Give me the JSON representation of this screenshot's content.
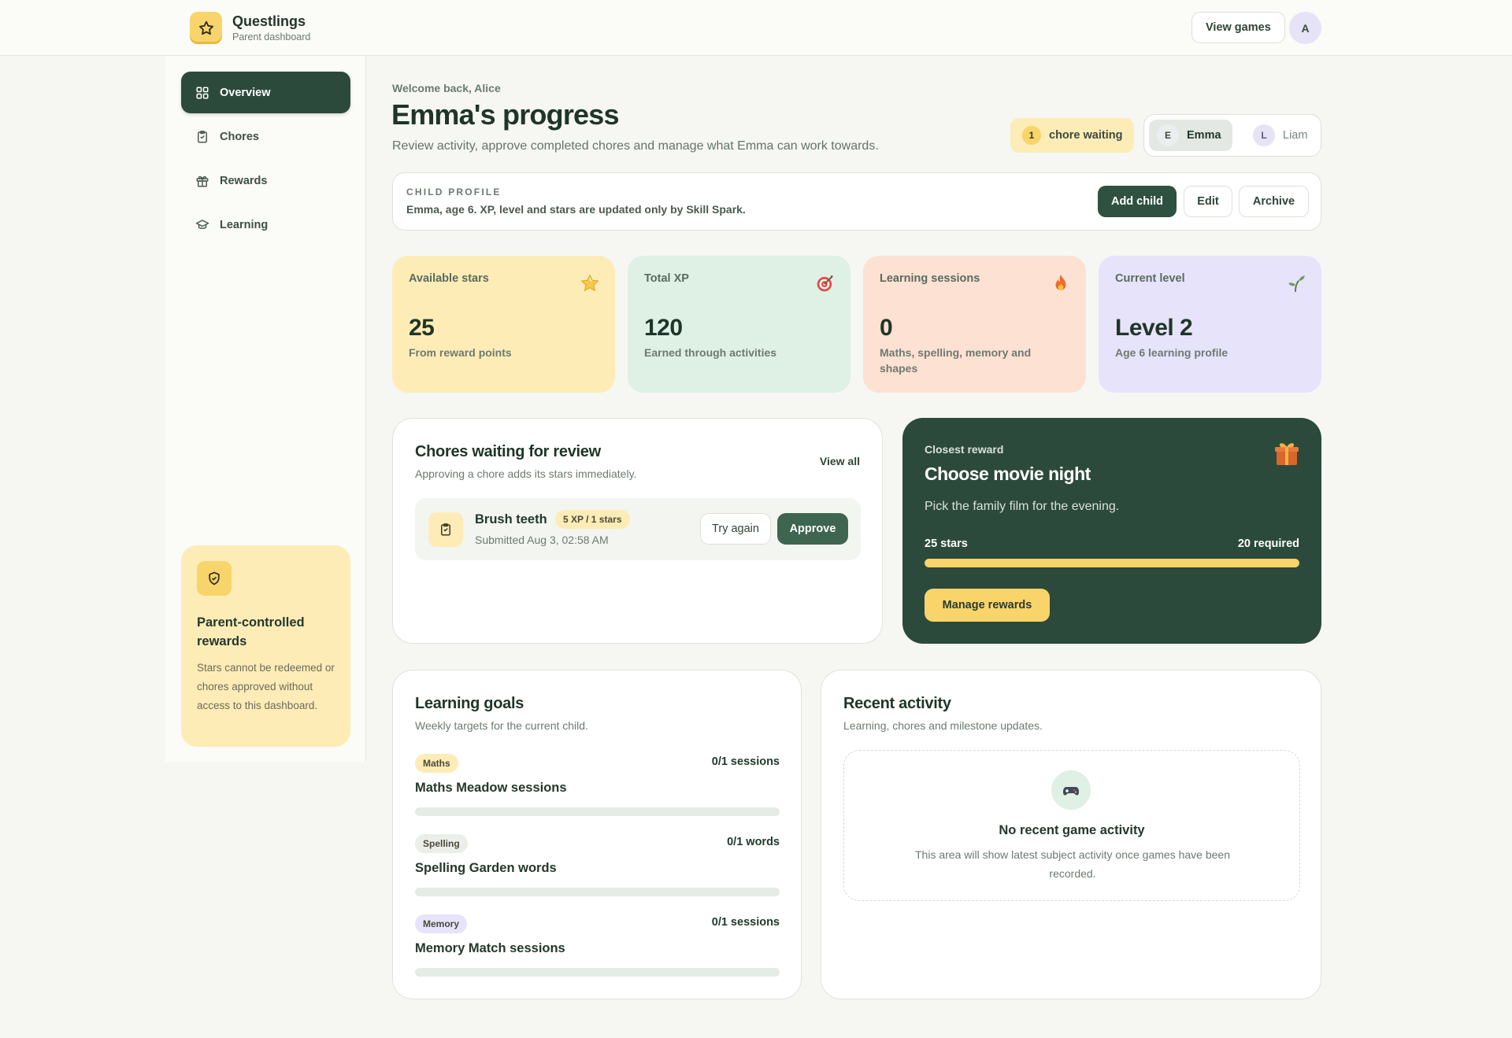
{
  "app": {
    "name": "Questlings",
    "subtitle": "Parent dashboard",
    "view_games_label": "View games",
    "user_initial": "A",
    "logo_icon": "star-icon"
  },
  "sidebar": {
    "items": [
      {
        "label": "Overview",
        "icon": "grid-icon",
        "active": true
      },
      {
        "label": "Chores",
        "icon": "clipboard-icon",
        "active": false
      },
      {
        "label": "Rewards",
        "icon": "gift-icon",
        "active": false
      },
      {
        "label": "Learning",
        "icon": "graduation-cap-icon",
        "active": false
      }
    ],
    "card": {
      "icon": "shield-check-icon",
      "title": "Parent-controlled rewards",
      "text": "Stars cannot be redeemed or chores approved without access to this dashboard."
    }
  },
  "header": {
    "welcome": "Welcome back, Alice",
    "title": "Emma's progress",
    "subtitle": "Review activity, approve completed chores and manage what Emma can work towards.",
    "chore_waiting": {
      "count": "1",
      "label": "chore waiting"
    },
    "children": [
      {
        "initial": "E",
        "name": "Emma",
        "selected": true
      },
      {
        "initial": "L",
        "name": "Liam",
        "selected": false
      }
    ]
  },
  "profile": {
    "label": "CHILD PROFILE",
    "text": "Emma, age 6. XP, level and stars are updated only by Skill Spark.",
    "add_child": "Add child",
    "edit": "Edit",
    "archive": "Archive"
  },
  "stats": [
    {
      "label": "Available stars",
      "value": "25",
      "sub": "From reward points",
      "icon": "star-emoji-icon"
    },
    {
      "label": "Total XP",
      "value": "120",
      "sub": "Earned through activities",
      "icon": "target-icon"
    },
    {
      "label": "Learning sessions",
      "value": "0",
      "sub": "Maths, spelling, memory and shapes",
      "icon": "fire-icon"
    },
    {
      "label": "Current level",
      "value": "Level 2",
      "sub": "Age 6 learning profile",
      "icon": "seedling-icon"
    }
  ],
  "chores": {
    "title": "Chores waiting for review",
    "subtitle": "Approving a chore adds its stars immediately.",
    "view_all": "View all",
    "items": [
      {
        "name": "Brush teeth",
        "badge": "5 XP / 1 stars",
        "submitted": "Submitted Aug 3, 02:58 AM",
        "try_again": "Try again",
        "approve": "Approve"
      }
    ]
  },
  "reward": {
    "label": "Closest reward",
    "title": "Choose movie night",
    "description": "Pick the family film for the evening.",
    "have": "25 stars",
    "need": "20 required",
    "progress": 1.0,
    "button": "Manage rewards",
    "icon": "gift-box-icon"
  },
  "goals": {
    "title": "Learning goals",
    "subtitle": "Weekly targets for the current child.",
    "items": [
      {
        "tag": "Maths",
        "tag_color": "#fdecb6",
        "count": "0/1 sessions",
        "name": "Maths Meadow sessions",
        "progress": 0
      },
      {
        "tag": "Spelling",
        "tag_color": "#ebeee9",
        "count": "0/1 words",
        "name": "Spelling Garden words",
        "progress": 0
      },
      {
        "tag": "Memory",
        "tag_color": "#e6e3fb",
        "count": "0/1 sessions",
        "name": "Memory Match sessions",
        "progress": 0
      }
    ]
  },
  "activity": {
    "title": "Recent activity",
    "subtitle": "Learning, chores and milestone updates.",
    "empty_title": "No recent game activity",
    "empty_text": "This area will show latest subject activity once games have been recorded.",
    "empty_icon": "gamepad-icon"
  }
}
